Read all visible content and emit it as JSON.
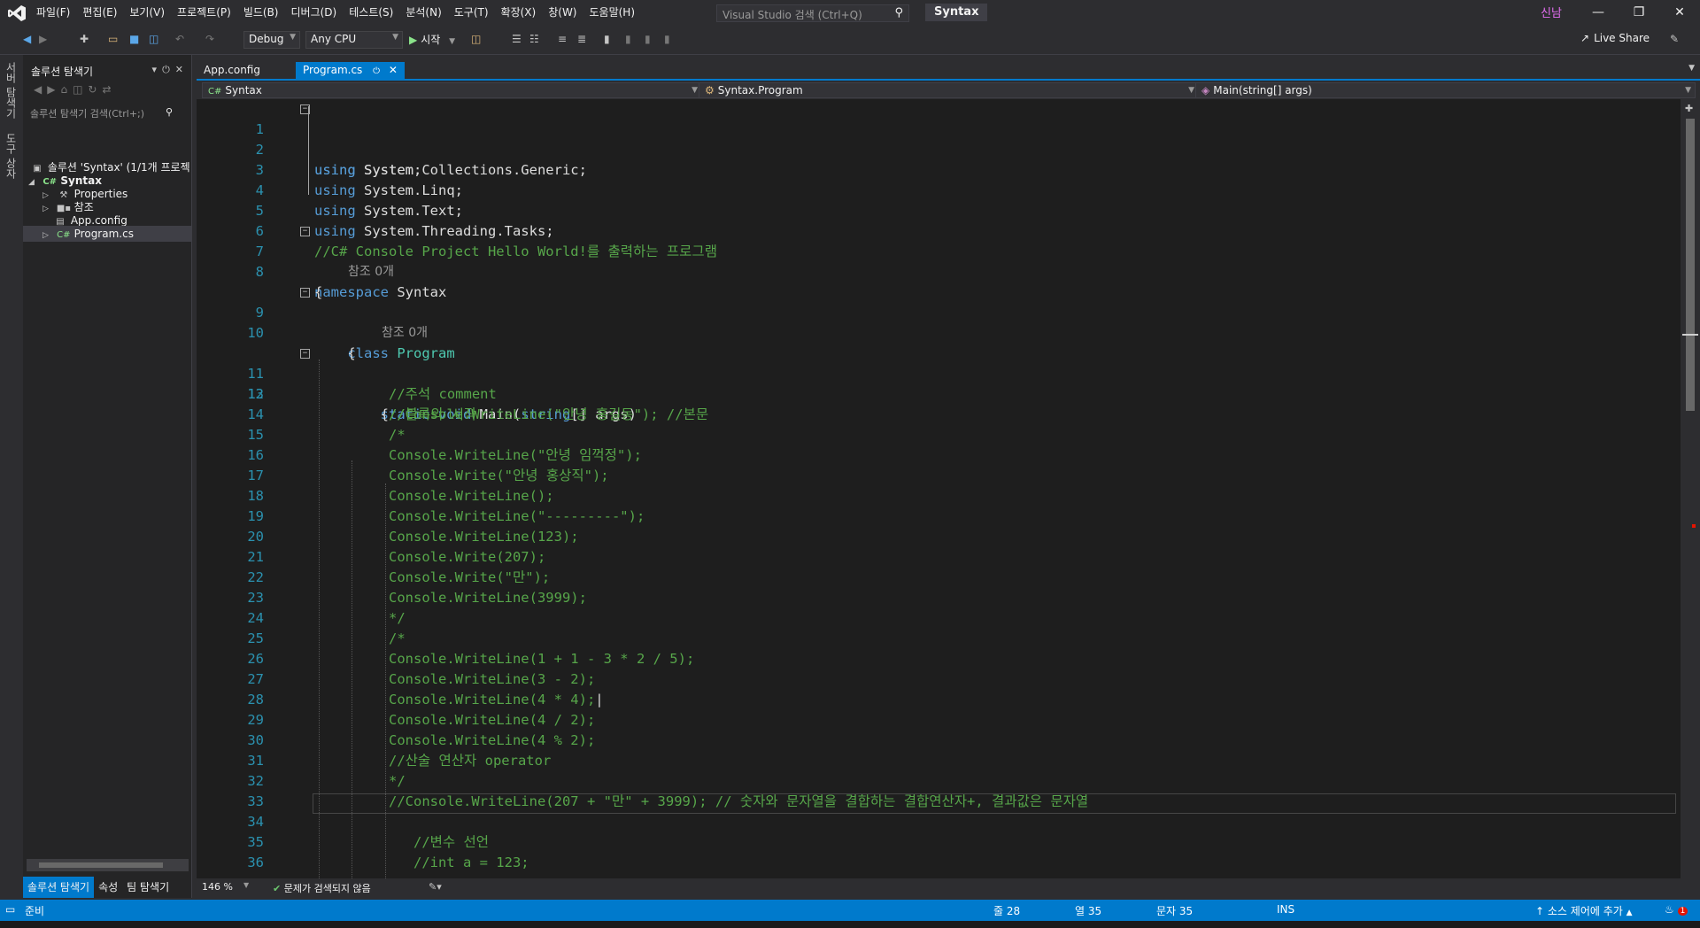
{
  "menu": [
    "파일(F)",
    "편집(E)",
    "보기(V)",
    "프로젝트(P)",
    "빌드(B)",
    "디버그(D)",
    "테스트(S)",
    "분석(N)",
    "도구(T)",
    "확장(X)",
    "창(W)",
    "도움말(H)"
  ],
  "search": {
    "placeholder": "Visual Studio 검색 (Ctrl+Q)"
  },
  "solution_title": "Syntax",
  "user": "신남",
  "toolbar": {
    "config": "Debug",
    "platform": "Any CPU",
    "start": "시작",
    "live_share": "Live Share"
  },
  "left_strip": [
    "서버 탐색기",
    "도구 상자"
  ],
  "solution_explorer": {
    "title": "솔루션 탐색기",
    "search_placeholder": "솔루션 탐색기 검색(Ctrl+;)",
    "items": [
      {
        "label": "솔루션 'Syntax' (1/1개 프로젝",
        "icon": "solution-icon"
      },
      {
        "label": "Syntax",
        "icon": "csproj-icon"
      },
      {
        "label": "Properties",
        "icon": "wrench-icon"
      },
      {
        "label": "참조",
        "icon": "references-icon"
      },
      {
        "label": "App.config",
        "icon": "config-file-icon"
      },
      {
        "label": "Program.cs",
        "icon": "csharp-file-icon"
      }
    ]
  },
  "bottom_tabs": [
    "솔루션 탐색기",
    "속성",
    "팀 탐색기"
  ],
  "doc_tabs": [
    "App.config",
    "Program.cs"
  ],
  "nav": {
    "project": "Syntax",
    "type": "Syntax.Program",
    "member": "Main(string[] args)"
  },
  "code": {
    "lens_text": "참조 0개",
    "l1_kw": "using",
    "l1_rest": " System;",
    "l2_kw": "using",
    "l2_rest": " System.Collections.Generic;",
    "l3_kw": "using",
    "l3_rest": " System.Linq;",
    "l4_kw": "using",
    "l4_rest": " System.Text;",
    "l5_kw": "using",
    "l5_rest": " System.Threading.Tasks;",
    "l6": "//C# Console Project Hello World!를 출력하는 프로그램",
    "l7_kw": "namespace",
    "l7_rest": " Syntax",
    "l8": "{",
    "l9_kw": "class",
    "l9_cls": " Program",
    "l10": "{",
    "l11_kw": "static void",
    "l11_id": " Main(",
    "l11_kw2": "string",
    "l11_rest": "[] args)",
    "l12_brace": "{",
    "l12_cm": "//블록의 시작",
    "l13": "//주석 comment",
    "l14": "//Console.WriteLine(\"안녕 홍길동\"); //본문",
    "l15": "/*",
    "l16": "Console.WriteLine(\"안녕 임꺽정\");",
    "l17": "Console.Write(\"안녕 홍상직\");",
    "l18": "Console.WriteLine();",
    "l19": "Console.WriteLine(\"---------\");",
    "l20": "Console.WriteLine(123);",
    "l21": "Console.Write(207);",
    "l22": "Console.Write(\"만\");",
    "l23": "Console.WriteLine(3999);",
    "l24": "*/",
    "l25": "/*",
    "l26": "Console.WriteLine(1 + 1 - 3 * 2 / 5);",
    "l27": "Console.WriteLine(3 - 2);",
    "l28": "Console.WriteLine(4 * 4);",
    "l29": "Console.WriteLine(4 / 2);",
    "l30": "Console.WriteLine(4 % 2);",
    "l31": "//산술 연산자 operator",
    "l32": "*/",
    "l33": "//Console.WriteLine(207 + \"만\" + 3999); // 숫자와 문자열을 결합하는 결합연산자+, 결과값은 문자열",
    "l34": "",
    "l35": "//변수 선언",
    "l36": "//int a = 123;"
  },
  "editor_status": {
    "zoom": "146 %",
    "issues": "문제가 검색되지 않음"
  },
  "statusbar": {
    "ready": "준비",
    "line": "줄 28",
    "col": "열 35",
    "char": "문자 35",
    "mode": "INS",
    "source_control": "소스 제어에 추가",
    "notifications": "1"
  }
}
